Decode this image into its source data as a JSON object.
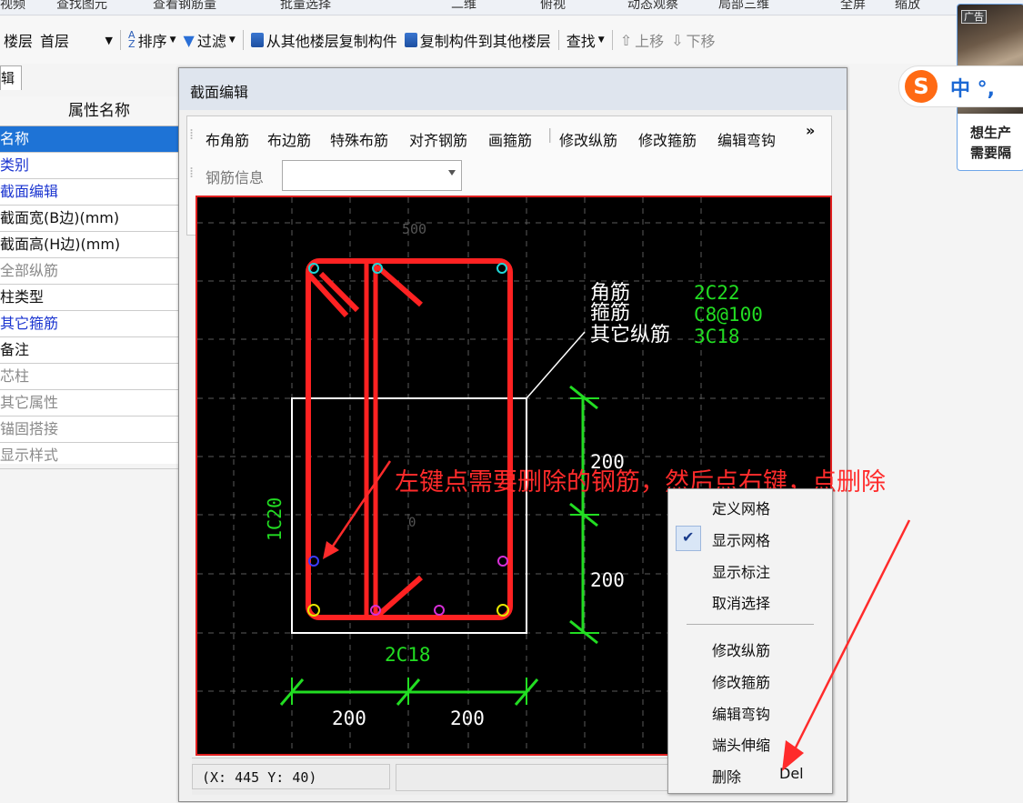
{
  "toolbar_top": {
    "items": [
      "视频",
      "查找图元",
      "查看钢筋量",
      "批量选择",
      "二维",
      "俯视",
      "动态观察",
      "局部三维",
      "全屏",
      "缩放"
    ]
  },
  "toolbar_main": {
    "floor_label": "楼层",
    "floor_value": "首层",
    "sort": "排序",
    "filter": "过滤",
    "copy_from": "从其他楼层复制构件",
    "copy_to": "复制构件到其他楼层",
    "find": "查找",
    "move_up": "上移",
    "move_down": "下移"
  },
  "panel": {
    "tab": "辑",
    "header": "属性名称",
    "rows": [
      {
        "label": "名称",
        "style": "sel"
      },
      {
        "label": "类别",
        "style": "blue"
      },
      {
        "label": "截面编辑",
        "style": "blue"
      },
      {
        "label": "截面宽(B边)(mm)",
        "style": "normal"
      },
      {
        "label": "截面高(H边)(mm)",
        "style": "normal"
      },
      {
        "label": "全部纵筋",
        "style": "gray"
      },
      {
        "label": "柱类型",
        "style": "normal"
      },
      {
        "label": "其它箍筋",
        "style": "blue"
      },
      {
        "label": "备注",
        "style": "normal"
      },
      {
        "label": "芯柱",
        "style": "gray"
      },
      {
        "label": "其它属性",
        "style": "gray"
      },
      {
        "label": "锚固搭接",
        "style": "gray"
      },
      {
        "label": "显示样式",
        "style": "gray"
      }
    ]
  },
  "dialog": {
    "title": "截面编辑",
    "tools": [
      "布角筋",
      "布边筋",
      "特殊布筋",
      "对齐钢筋",
      "画箍筋",
      "修改纵筋",
      "修改箍筋",
      "编辑弯钩"
    ],
    "more": "»",
    "rebar_info_label": "钢筋信息",
    "status_coords": "(X: 445 Y: 40)"
  },
  "drawing": {
    "top_tick": "500",
    "origin_tick": "0",
    "labels": [
      {
        "name": "角筋",
        "value": "2C22"
      },
      {
        "name": "箍筋",
        "value": "C8@100"
      },
      {
        "name": "其它纵筋",
        "value": "3C18"
      }
    ],
    "side_label": "1C20",
    "bottom_label": "2C18",
    "dims_vertical": [
      "200",
      "200"
    ],
    "dims_horizontal": [
      "200",
      "200"
    ]
  },
  "annotation": "左键点需要删除的钢筋，然后点右键，点删除",
  "context_menu": {
    "items": [
      "定义网格",
      "显示网格",
      "显示标注",
      "取消选择"
    ],
    "items2": [
      "修改纵筋",
      "修改箍筋",
      "编辑弯钩",
      "端头伸缩",
      "删除"
    ],
    "delete_shortcut": "Del",
    "checked": "显示网格"
  },
  "ad": {
    "tag": "广告",
    "line1": "想生产",
    "line2": "需要隔"
  },
  "ime": {
    "logo": "S",
    "text": "中 °,"
  },
  "colors": {
    "accent_red": "#e02020",
    "rebar_green": "#22dd22",
    "selected_blue": "#1e73d6",
    "annotation_red": "#ff2b2b"
  }
}
